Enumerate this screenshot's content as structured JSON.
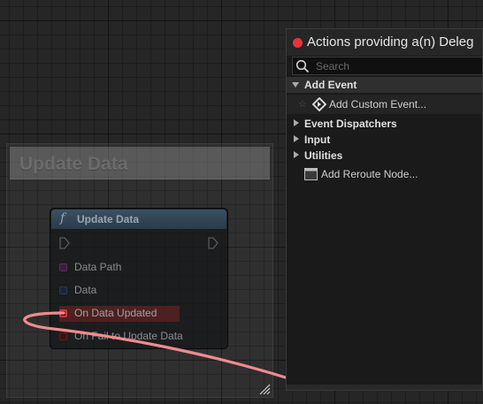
{
  "graph": {
    "comment_title": "Update Data",
    "node": {
      "title": "Update Data",
      "pins": [
        {
          "label": "Data Path",
          "color": "#7a2f7a"
        },
        {
          "label": "Data",
          "color": "#2a4c8a"
        },
        {
          "label": "On Data Updated",
          "color": "#c8383c"
        },
        {
          "label": "On Fail to Update Data",
          "color": "#c8383c"
        }
      ]
    },
    "wire_color": "#f08b8e"
  },
  "action_menu": {
    "title": "Actions providing a(n) Deleg",
    "search_placeholder": "Search",
    "categories": {
      "add_event": "Add Event",
      "event_dispatchers": "Event Dispatchers",
      "input": "Input",
      "utilities": "Utilities"
    },
    "items": {
      "add_custom_event": "Add Custom Event...",
      "add_reroute_node": "Add Reroute Node..."
    },
    "accent_color": "#e8333c"
  }
}
